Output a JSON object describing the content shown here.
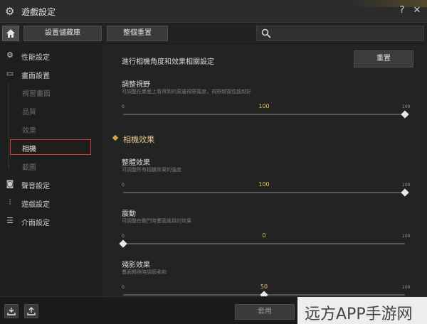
{
  "window": {
    "title": "遊戲設定",
    "help_glyph": "?",
    "close_glyph": "✕"
  },
  "toolbar": {
    "save_library_label": "設置儲藏庫",
    "reset_all_label": "整個重置",
    "search_placeholder": ""
  },
  "sidebar": {
    "items": [
      {
        "label": "性能設定",
        "icon": "performance-icon"
      },
      {
        "label": "畫面設置",
        "icon": "monitor-icon"
      },
      {
        "label": "聲音設定",
        "icon": "speaker-icon"
      },
      {
        "label": "遊戲設定",
        "icon": "sliders-icon"
      },
      {
        "label": "介面設定",
        "icon": "list-icon"
      }
    ],
    "sub_items": [
      {
        "label": "視窗畫面"
      },
      {
        "label": "品質"
      },
      {
        "label": "效果"
      },
      {
        "label": "相機",
        "active": true
      },
      {
        "label": "截圖"
      }
    ]
  },
  "main": {
    "heading": "進行相機角度和效果相關設定",
    "reset_label": "重置",
    "section_label": "相機效果",
    "settings": [
      {
        "title": "調整視野",
        "desc": "可調整在畫面上看得到的周邊視野寬度，視野越寬性能越好",
        "min": "0",
        "max": "100",
        "value": "100",
        "value_num": 100
      },
      {
        "title": "整體效果",
        "desc": "可調整所有相機效果的強度",
        "min": "0",
        "max": "100",
        "value": "100",
        "value_num": 100
      },
      {
        "title": "震動",
        "desc": "可調整在戰鬥時畫面搖晃的效果",
        "min": "0",
        "max": "100",
        "value": "0",
        "value_num": 0
      },
      {
        "title": "殘影效果",
        "desc": "畫面轉換時調節柔和",
        "min": "0",
        "max": "100",
        "value": "50",
        "value_num": 50
      }
    ]
  },
  "footer": {
    "apply_label": "套用"
  },
  "watermark": {
    "text": "远方APP手游网"
  },
  "colors": {
    "accent": "#e6c36a",
    "active_outline": "#d23a3a"
  }
}
